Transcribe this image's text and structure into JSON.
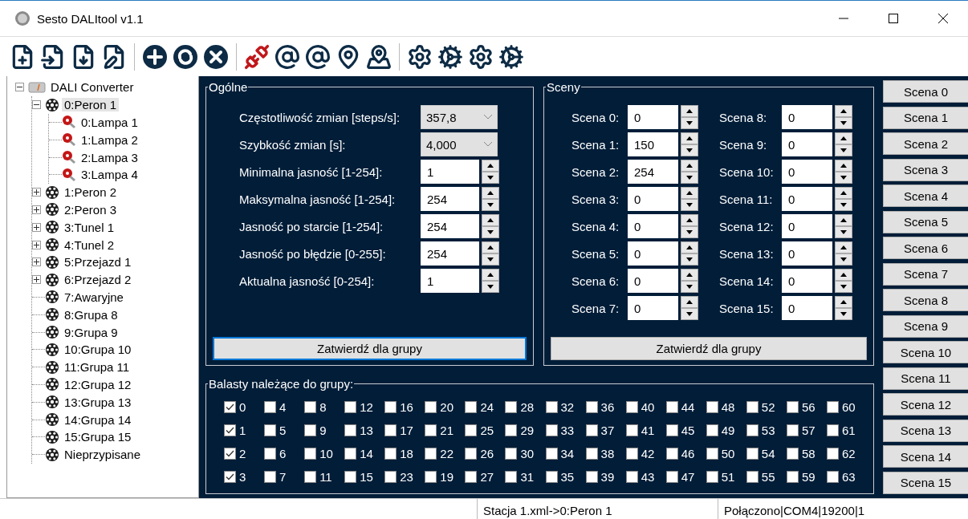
{
  "window": {
    "title": "Sesto DALItool v1.1"
  },
  "tree": {
    "label": "DALI Converter",
    "kind": "converter",
    "expanded": true,
    "selected": false,
    "children": [
      {
        "label": "0:Peron 1",
        "kind": "group",
        "expanded": true,
        "selected": true,
        "children": [
          {
            "label": "0:Lampa 1",
            "kind": "lamp",
            "selected": false
          },
          {
            "label": "1:Lampa 2",
            "kind": "lamp",
            "selected": false
          },
          {
            "label": "2:Lampa 3",
            "kind": "lamp",
            "selected": false
          },
          {
            "label": "3:Lampa 4",
            "kind": "lamp",
            "selected": false
          }
        ]
      },
      {
        "label": "1:Peron 2",
        "kind": "group",
        "expanded": false,
        "selected": false
      },
      {
        "label": "2:Peron 3",
        "kind": "group",
        "expanded": false,
        "selected": false
      },
      {
        "label": "3:Tunel 1",
        "kind": "group",
        "expanded": false,
        "selected": false
      },
      {
        "label": "4:Tunel 2",
        "kind": "group",
        "expanded": false,
        "selected": false
      },
      {
        "label": "5:Przejazd 1",
        "kind": "group",
        "expanded": false,
        "selected": false
      },
      {
        "label": "6:Przejazd 2",
        "kind": "group",
        "expanded": false,
        "selected": false
      },
      {
        "label": "7:Awaryjne",
        "kind": "group",
        "selected": false
      },
      {
        "label": "8:Grupa 8",
        "kind": "group",
        "selected": false
      },
      {
        "label": "9:Grupa 9",
        "kind": "group",
        "selected": false
      },
      {
        "label": "10:Grupa 10",
        "kind": "group",
        "selected": false
      },
      {
        "label": "11:Grupa 11",
        "kind": "group",
        "selected": false
      },
      {
        "label": "12:Grupa 12",
        "kind": "group",
        "selected": false
      },
      {
        "label": "13:Grupa 13",
        "kind": "group",
        "selected": false
      },
      {
        "label": "14:Grupa 14",
        "kind": "group",
        "selected": false
      },
      {
        "label": "15:Grupa 15",
        "kind": "group",
        "selected": false
      },
      {
        "label": "Nieprzypisane",
        "kind": "group",
        "selected": false
      }
    ]
  },
  "general": {
    "title": "Ogólne",
    "fields": [
      {
        "label": "Częstotliwość zmian [steps/s]:",
        "kind": "dropdown",
        "value": "357,8"
      },
      {
        "label": "Szybkość zmian [s]:",
        "kind": "dropdown",
        "value": "4,000"
      },
      {
        "label": "Minimalna jasność [1-254]:",
        "kind": "spin",
        "value": "1"
      },
      {
        "label": "Maksymalna jasność [1-254]:",
        "kind": "spin",
        "value": "254"
      },
      {
        "label": "Jasność po starcie [1-254]:",
        "kind": "spin",
        "value": "254"
      },
      {
        "label": "Jasność po błędzie [0-255]:",
        "kind": "spin",
        "value": "254"
      },
      {
        "label": "Aktualna jasność [0-254]:",
        "kind": "spin",
        "value": "1"
      }
    ],
    "button": "Zatwierdź dla grupy"
  },
  "scenes": {
    "title": "Sceny",
    "fields": [
      {
        "label": "Scena 0:",
        "value": "0"
      },
      {
        "label": "Scena 8:",
        "value": "0"
      },
      {
        "label": "Scena 1:",
        "value": "150"
      },
      {
        "label": "Scena 9:",
        "value": "0"
      },
      {
        "label": "Scena 2:",
        "value": "254"
      },
      {
        "label": "Scena 10:",
        "value": "0"
      },
      {
        "label": "Scena 3:",
        "value": "0"
      },
      {
        "label": "Scena 11:",
        "value": "0"
      },
      {
        "label": "Scena 4:",
        "value": "0"
      },
      {
        "label": "Scena 12:",
        "value": "0"
      },
      {
        "label": "Scena 5:",
        "value": "0"
      },
      {
        "label": "Scena 13:",
        "value": "0"
      },
      {
        "label": "Scena 6:",
        "value": "0"
      },
      {
        "label": "Scena 14:",
        "value": "0"
      },
      {
        "label": "Scena 7:",
        "value": "0"
      },
      {
        "label": "Scena 15:",
        "value": "0"
      }
    ],
    "button": "Zatwierdź dla grupy"
  },
  "ballasts": {
    "title": "Balasty należące do grupy:",
    "items": [
      {
        "label": "0",
        "checked": true
      },
      {
        "label": "4",
        "checked": false
      },
      {
        "label": "8",
        "checked": false
      },
      {
        "label": "12",
        "checked": false
      },
      {
        "label": "16",
        "checked": false
      },
      {
        "label": "20",
        "checked": false
      },
      {
        "label": "24",
        "checked": false
      },
      {
        "label": "28",
        "checked": false
      },
      {
        "label": "32",
        "checked": false
      },
      {
        "label": "36",
        "checked": false
      },
      {
        "label": "40",
        "checked": false
      },
      {
        "label": "44",
        "checked": false
      },
      {
        "label": "48",
        "checked": false
      },
      {
        "label": "52",
        "checked": false
      },
      {
        "label": "56",
        "checked": false
      },
      {
        "label": "60",
        "checked": false
      },
      {
        "label": "1",
        "checked": true
      },
      {
        "label": "5",
        "checked": false
      },
      {
        "label": "9",
        "checked": false
      },
      {
        "label": "13",
        "checked": false
      },
      {
        "label": "17",
        "checked": false
      },
      {
        "label": "21",
        "checked": false
      },
      {
        "label": "25",
        "checked": false
      },
      {
        "label": "29",
        "checked": false
      },
      {
        "label": "33",
        "checked": false
      },
      {
        "label": "37",
        "checked": false
      },
      {
        "label": "41",
        "checked": false
      },
      {
        "label": "45",
        "checked": false
      },
      {
        "label": "49",
        "checked": false
      },
      {
        "label": "53",
        "checked": false
      },
      {
        "label": "57",
        "checked": false
      },
      {
        "label": "61",
        "checked": false
      },
      {
        "label": "2",
        "checked": true
      },
      {
        "label": "6",
        "checked": false
      },
      {
        "label": "10",
        "checked": false
      },
      {
        "label": "14",
        "checked": false
      },
      {
        "label": "18",
        "checked": false
      },
      {
        "label": "22",
        "checked": false
      },
      {
        "label": "26",
        "checked": false
      },
      {
        "label": "30",
        "checked": false
      },
      {
        "label": "34",
        "checked": false
      },
      {
        "label": "38",
        "checked": false
      },
      {
        "label": "42",
        "checked": false
      },
      {
        "label": "46",
        "checked": false
      },
      {
        "label": "50",
        "checked": false
      },
      {
        "label": "54",
        "checked": false
      },
      {
        "label": "58",
        "checked": false
      },
      {
        "label": "62",
        "checked": false
      },
      {
        "label": "3",
        "checked": true
      },
      {
        "label": "7",
        "checked": false
      },
      {
        "label": "11",
        "checked": false
      },
      {
        "label": "15",
        "checked": false
      },
      {
        "label": "23",
        "checked": false
      },
      {
        "label": "19",
        "checked": false
      },
      {
        "label": "27",
        "checked": false
      },
      {
        "label": "31",
        "checked": false
      },
      {
        "label": "35",
        "checked": false
      },
      {
        "label": "39",
        "checked": false
      },
      {
        "label": "43",
        "checked": false
      },
      {
        "label": "47",
        "checked": false
      },
      {
        "label": "51",
        "checked": false
      },
      {
        "label": "55",
        "checked": false
      },
      {
        "label": "59",
        "checked": false
      },
      {
        "label": "63",
        "checked": false
      }
    ]
  },
  "scene_buttons": [
    "Scena 0",
    "Scena 1",
    "Scena 2",
    "Scena 3",
    "Scena 4",
    "Scena 5",
    "Scena 6",
    "Scena 7",
    "Scena 8",
    "Scena 9",
    "Scena 10",
    "Scena 11",
    "Scena 12",
    "Scena 13",
    "Scena 14",
    "Scena 15"
  ],
  "status_bar": [
    "Stacja 1.xml->0:Peron 1",
    "Połączono|COM4|19200|1"
  ]
}
